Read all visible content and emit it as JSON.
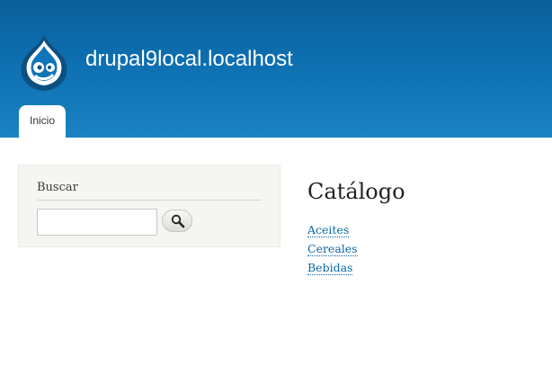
{
  "header": {
    "site_name": "drupal9local.localhost",
    "logo_icon": "drupal-drop-icon",
    "gradient_top": "#0a5f9a",
    "gradient_bottom": "#1a82c2",
    "nav": {
      "tabs": [
        {
          "label": "Inicio",
          "active": true
        }
      ]
    }
  },
  "sidebar": {
    "search_block": {
      "title": "Buscar",
      "input_value": "",
      "button_icon": "search-icon"
    }
  },
  "main": {
    "title": "Catálogo",
    "links": [
      {
        "label": "Aceites"
      },
      {
        "label": "Cereales"
      },
      {
        "label": "Bebidas"
      }
    ],
    "link_color": "#0b67a8"
  }
}
